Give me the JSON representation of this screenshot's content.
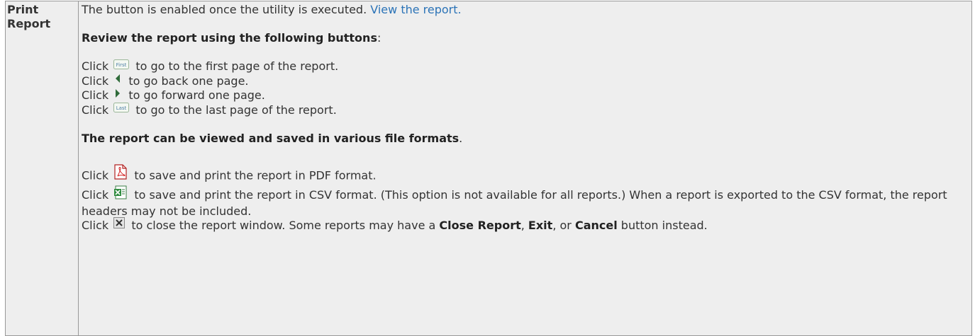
{
  "table": {
    "term": "Print Report",
    "intro_text": "The button is enabled once the utility is executed.",
    "intro_link": "View the report.",
    "review_heading": "Review the report using the following buttons",
    "review_colon": ":",
    "nav_lines": [
      {
        "click": "Click",
        "icon": "first-page-icon",
        "text": "to go to the first page of the report."
      },
      {
        "click": "Click",
        "icon": "previous-page-icon",
        "text": "to go back one page."
      },
      {
        "click": "Click",
        "icon": "next-page-icon",
        "text": "to go forward one page."
      },
      {
        "click": "Click",
        "icon": "last-page-icon",
        "text": "to go to the last page of the report."
      }
    ],
    "first_label": "First",
    "last_label": "Last",
    "formats_heading": "The report can be viewed and saved in various file formats",
    "formats_period": ".",
    "format_lines": [
      {
        "click": "Click",
        "icon": "pdf-icon",
        "text": "to save and print the report in PDF format."
      },
      {
        "click": "Click",
        "icon": "csv-icon",
        "text": "to save and print the report in CSV format. (This option is not available for all reports.) When a report is exported to the CSV format, the report headers may not be included."
      }
    ],
    "close_line": {
      "click": "Click",
      "icon": "close-icon",
      "text_a": "to close the report window. Some reports may have a",
      "b1": "Close Report",
      "sep1": ",",
      "b2": "Exit",
      "sep2": ", or",
      "b3": "Cancel",
      "text_b": "button instead."
    }
  }
}
